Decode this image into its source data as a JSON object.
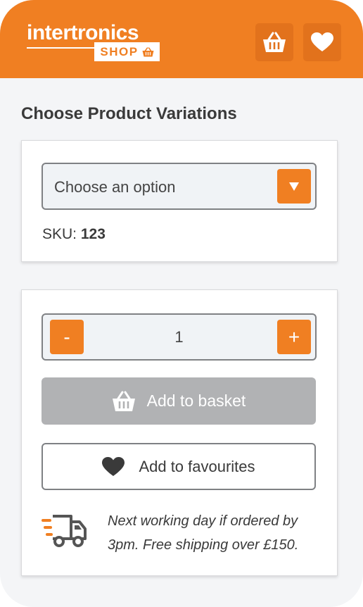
{
  "header": {
    "logo_word": "intertronics",
    "logo_shop": "SHOP",
    "brand_color": "#f07f22",
    "icons": [
      "basket-icon",
      "heart-icon"
    ]
  },
  "section_title": "Choose Product Variations",
  "variation": {
    "select_value": "Choose an option",
    "sku_label": "SKU:",
    "sku_value": "123"
  },
  "purchase": {
    "minus_label": "-",
    "plus_label": "+",
    "quantity": "1",
    "add_to_basket": "Add to basket",
    "add_to_favourites": "Add to favourites",
    "shipping_text": "Next working day if ordered by 3pm. Free shipping over £150."
  }
}
